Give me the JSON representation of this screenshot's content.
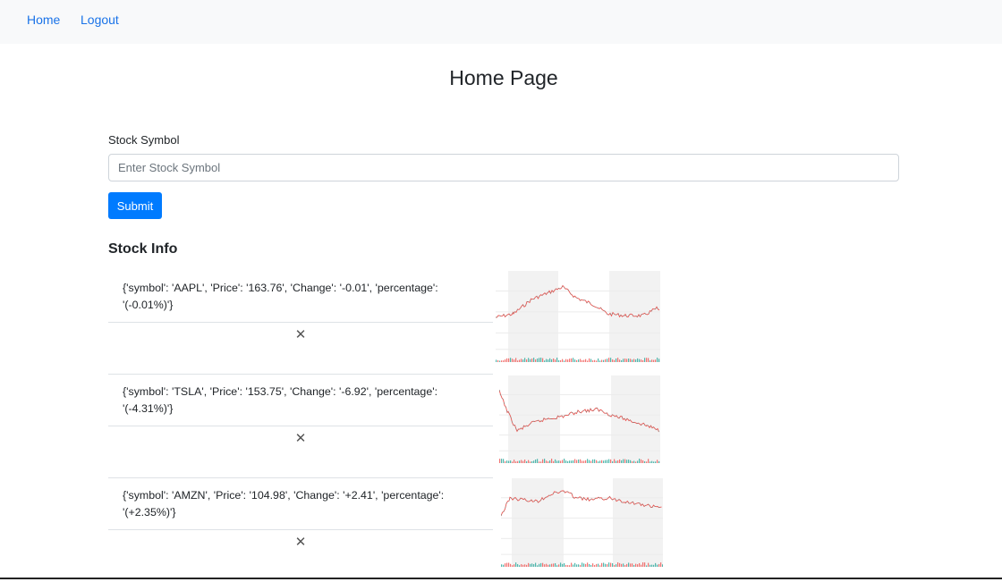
{
  "nav": {
    "home": "Home",
    "logout": "Logout"
  },
  "page": {
    "title": "Home Page"
  },
  "form": {
    "label": "Stock Symbol",
    "placeholder": "Enter Stock Symbol",
    "value": "",
    "submit_label": "Submit"
  },
  "section": {
    "title": "Stock Info"
  },
  "stocks": [
    {
      "text": "{'symbol': 'AAPL', 'Price': '163.76', 'Change': '-0.01', 'percentage': '(-0.01%)'}",
      "remove": "✕"
    },
    {
      "text": "{'symbol': 'TSLA', 'Price': '153.75', 'Change': '-6.92', 'percentage': '(-4.31%)'}",
      "remove": "✕"
    },
    {
      "text": "{'symbol': 'AMZN', 'Price': '104.98', 'Change': '+2.41', 'percentage': '(+2.35%)'}",
      "remove": "✕"
    }
  ],
  "colors": {
    "accent": "#007bff",
    "link": "#1a73e8",
    "up": "#26a69a",
    "down": "#ef5350"
  }
}
